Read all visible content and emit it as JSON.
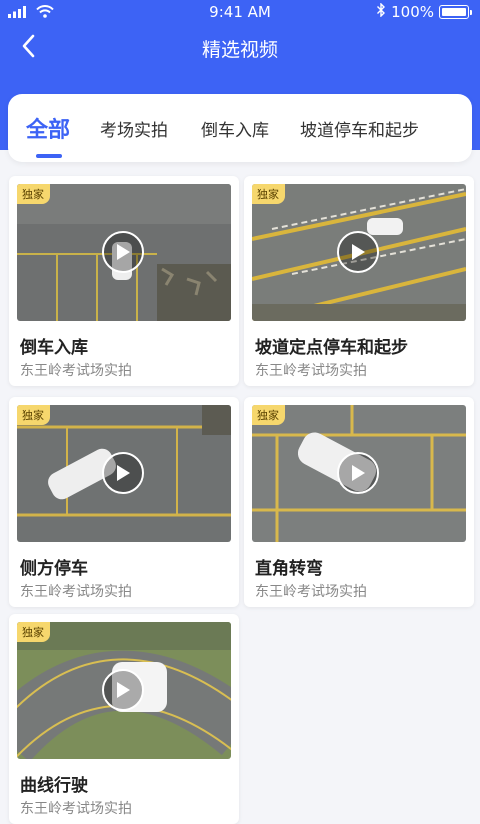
{
  "status_bar": {
    "time": "9:41 AM",
    "battery": "100%"
  },
  "nav": {
    "title": "精选视频",
    "back_icon": "chevron-left-icon"
  },
  "tabs": [
    {
      "label": "全部",
      "active": true
    },
    {
      "label": "考场实拍",
      "active": false
    },
    {
      "label": "倒车入库",
      "active": false
    },
    {
      "label": "坡道停车和起步",
      "active": false
    }
  ],
  "videos": [
    {
      "badge": "独家",
      "title": "倒车入库",
      "subtitle": "东王岭考试场实拍"
    },
    {
      "badge": "独家",
      "title": "坡道定点停车和起步",
      "subtitle": "东王岭考试场实拍"
    },
    {
      "badge": "独家",
      "title": "侧方停车",
      "subtitle": "东王岭考试场实拍"
    },
    {
      "badge": "独家",
      "title": "直角转弯",
      "subtitle": "东王岭考试场实拍"
    },
    {
      "badge": "独家",
      "title": "曲线行驶",
      "subtitle": "东王岭考试场实拍"
    }
  ],
  "colors": {
    "primary": "#3d63f5",
    "badge": "#f6d76d",
    "background": "#f4f5f9"
  }
}
